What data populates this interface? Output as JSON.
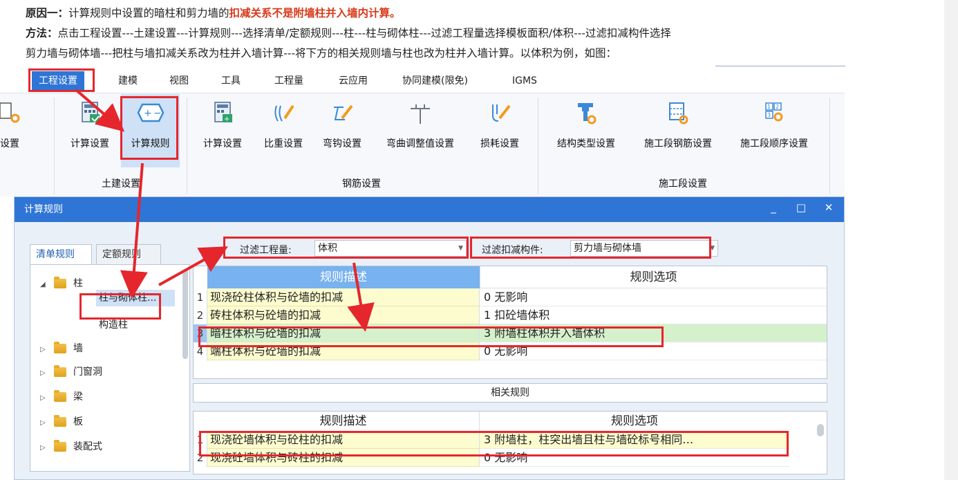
{
  "article": {
    "line1_prefix": "原因一：",
    "line1_text": "计算规则中设置的暗柱和剪力墙的",
    "line1_emph": "扣减关系不是附墙柱并入墙内计算",
    "line1_end": "。",
    "line2_prefix": "方法：",
    "line2_text": "点击工程设置---土建设置---计算规则---选择清单/定额规则---柱---柱与砌体柱---过滤工程量选择模板面积/体积---过滤扣减构件选择",
    "line3_text": "剪力墙与砌体墙---把柱与墙扣减关系改为柱并入墙计算---将下方的相关规则墙与柱也改为柱并入墙计算。以体积为例，如图："
  },
  "ribbon": {
    "tabs": [
      "工程设置",
      "建模",
      "视图",
      "工具",
      "工程量",
      "云应用",
      "协同建模(限免)",
      "IGMS"
    ],
    "active_tab": "工程设置",
    "buttons": {
      "partial": "设置",
      "calc_settings_civil": "计算设置",
      "calc_rules": "计算规则",
      "calc_settings_rebar": "计算设置",
      "weight_settings": "比重设置",
      "hook_settings": "弯钩设置",
      "bend_adjust": "弯曲调整值设置",
      "loss_settings": "损耗设置",
      "struct_type": "结构类型设置",
      "stage_rebar": "施工段钢筋设置",
      "stage_order": "施工段顺序设置"
    },
    "groups": {
      "civil": "土建设置",
      "rebar": "钢筋设置",
      "stage": "施工段设置"
    }
  },
  "dialog": {
    "title": "计算规则",
    "controls": {
      "minimize": "_",
      "maximize": "□",
      "close": "✕"
    },
    "tabs": [
      "清单规则",
      "定额规则"
    ],
    "tree": {
      "items": [
        {
          "label": "柱",
          "level": 0,
          "expanded": true
        },
        {
          "label": "柱与砌体柱...",
          "level": 1,
          "selected": true
        },
        {
          "label": "构造柱",
          "level": 1
        },
        {
          "label": "墙",
          "level": 0
        },
        {
          "label": "门窗洞",
          "level": 0
        },
        {
          "label": "梁",
          "level": 0
        },
        {
          "label": "板",
          "level": 0
        },
        {
          "label": "装配式",
          "level": 0
        }
      ]
    },
    "filter": {
      "quantity_label": "过滤工程量:",
      "quantity_value": "体积",
      "deduct_label": "过滤扣减构件:",
      "deduct_value": "剪力墙与砌体墙"
    },
    "rules_table": {
      "headers": [
        "规则描述",
        "规则选项"
      ],
      "rows": [
        {
          "num": "1",
          "desc": "现浇砼柱体积与砼墙的扣减",
          "option": "0  无影响"
        },
        {
          "num": "2",
          "desc": "砖柱体积与砼墙的扣减",
          "option": "1  扣砼墙体积"
        },
        {
          "num": "3",
          "desc": "暗柱体积与砼墙的扣减",
          "option": "3  附墙柱体积并入墙体积",
          "selected": true
        },
        {
          "num": "4",
          "desc": "端柱体积与砼墙的扣减",
          "option": "0  无影响"
        }
      ]
    },
    "related_label": "相关规则",
    "related_table": {
      "headers": [
        "规则描述",
        "规则选项"
      ],
      "rows": [
        {
          "num": "1",
          "desc": "现浇砼墙体积与砼柱的扣减",
          "option": "3   附墙柱，柱突出墙且柱与墙砼标号相同…"
        },
        {
          "num": "2",
          "desc": "现浇砼墙体积与砖柱的扣减",
          "option": "0   无影响"
        }
      ]
    }
  },
  "colors": {
    "accent": "#2f75d6",
    "annotation_red": "#e5262c",
    "highlight_row": "#d4f1cc",
    "desc_cell": "#fcfccf"
  }
}
